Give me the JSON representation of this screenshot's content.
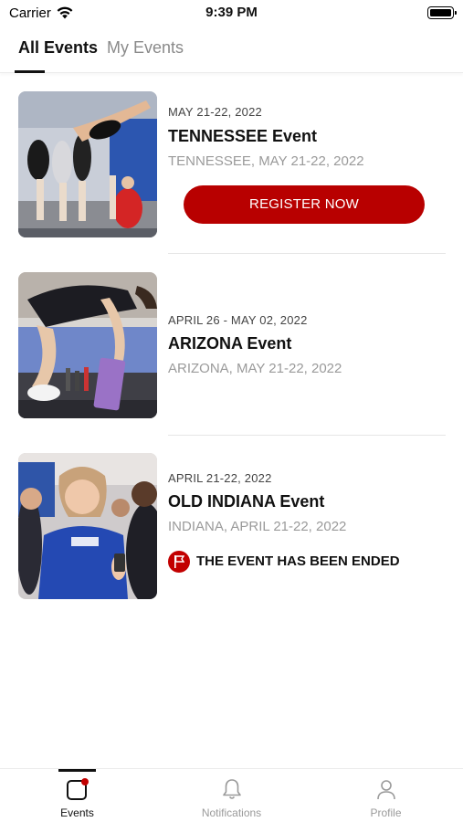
{
  "status_bar": {
    "carrier": "Carrier",
    "time": "9:39 PM"
  },
  "tabs": [
    {
      "label": "All Events",
      "active": true
    },
    {
      "label": "My Events",
      "active": false
    }
  ],
  "events": [
    {
      "date": "MAY 21-22, 2022",
      "title": "TENNESSEE Event",
      "location": "TENNESSEE, MAY 21-22, 2022",
      "action": "REGISTER NOW"
    },
    {
      "date": "APRIL 26 - MAY 02, 2022",
      "title": "ARIZONA Event",
      "location": "ARIZONA, MAY 21-22, 2022"
    },
    {
      "date": "APRIL 21-22, 2022",
      "title": "OLD INDIANA Event",
      "location": "INDIANA, APRIL 21-22, 2022",
      "status": "THE EVENT HAS BEEN ENDED"
    }
  ],
  "bottom_nav": [
    {
      "label": "Events",
      "icon": "events-icon",
      "active": true
    },
    {
      "label": "Notifications",
      "icon": "bell-icon",
      "active": false
    },
    {
      "label": "Profile",
      "icon": "person-icon",
      "active": false
    }
  ],
  "colors": {
    "accent": "#b80000",
    "active_text": "#111111",
    "inactive_text": "#9a9a9a"
  }
}
